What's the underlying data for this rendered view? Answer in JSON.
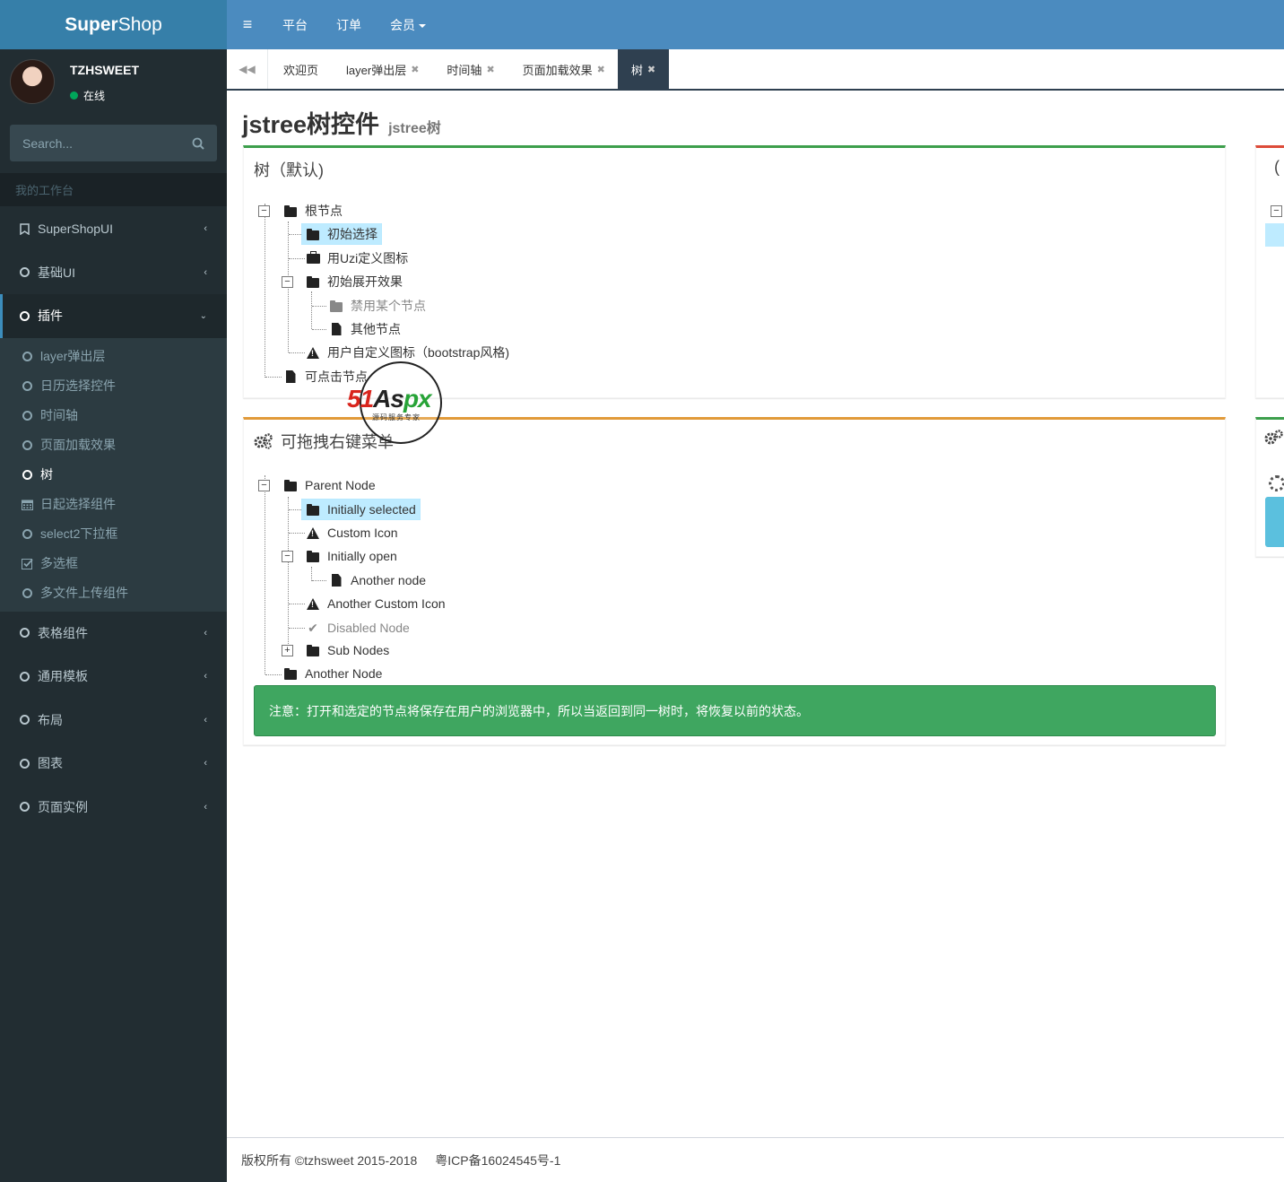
{
  "brand": {
    "bold": "Super",
    "light": "Shop"
  },
  "user": {
    "name": "TZHSWEET",
    "status": "在线"
  },
  "search": {
    "placeholder": "Search..."
  },
  "sidebar": {
    "section_header": "我的工作台",
    "items": [
      {
        "label": "SuperShopUI",
        "icon": "bookmark-icon"
      },
      {
        "label": "基础UI",
        "icon": "circle-icon"
      },
      {
        "label": "插件",
        "icon": "circle-icon",
        "active": true
      },
      {
        "label": "表格组件",
        "icon": "circle-icon"
      },
      {
        "label": "通用模板",
        "icon": "circle-icon"
      },
      {
        "label": "布局",
        "icon": "circle-icon"
      },
      {
        "label": "图表",
        "icon": "circle-icon"
      },
      {
        "label": "页面实例",
        "icon": "circle-icon"
      }
    ],
    "submenu": [
      {
        "label": "layer弹出层",
        "icon": "circle-icon"
      },
      {
        "label": "日历选择控件",
        "icon": "circle-icon"
      },
      {
        "label": "时间轴",
        "icon": "circle-icon"
      },
      {
        "label": "页面加载效果",
        "icon": "circle-icon"
      },
      {
        "label": "树",
        "icon": "circle-icon",
        "active": true
      },
      {
        "label": "日起选择组件",
        "icon": "calendar-icon"
      },
      {
        "label": "select2下拉框",
        "icon": "circle-icon"
      },
      {
        "label": "多选框",
        "icon": "checkbox-icon"
      },
      {
        "label": "多文件上传组件",
        "icon": "circle-icon"
      }
    ]
  },
  "navbar": {
    "links": [
      "平台",
      "订单",
      "会员"
    ]
  },
  "tabs": [
    {
      "label": "欢迎页",
      "closable": false
    },
    {
      "label": "layer弹出层",
      "closable": true
    },
    {
      "label": "时间轴",
      "closable": true
    },
    {
      "label": "页面加载效果",
      "closable": true
    },
    {
      "label": "树",
      "closable": true,
      "active": true
    }
  ],
  "page": {
    "title": "jstree树控件",
    "subtitle": "jstree树"
  },
  "box1": {
    "title": "树（默认)",
    "nodes": [
      "根节点",
      "初始选择",
      "用Uzi定义图标",
      "初始展开效果",
      "禁用某个节点",
      "其他节点",
      "用户自定义图标（bootstrap风格)",
      "可点击节点"
    ]
  },
  "box2": {
    "title": "可拖拽右键菜单",
    "nodes": [
      "Parent Node",
      "Initially selected",
      "Custom Icon",
      "Initially open",
      "Another node",
      "Another Custom Icon",
      "Disabled Node",
      "Sub Nodes",
      "Another Node"
    ],
    "alert": "注意：打开和选定的节点将保存在用户的浏览器中，所以当返回到同一树时，将恢复以前的状态。"
  },
  "right_box_title_fragment": "(",
  "watermark": {
    "red": "51",
    "black": "As",
    "green": "px",
    "sub": "源码服务专家"
  },
  "footer": {
    "copyright": "版权所有 ©tzhsweet 2015-2018",
    "icp": "粤ICP备16024545号-1"
  },
  "colors": {
    "sidebar_bg": "#222d32",
    "navbar_bg": "#4b8bbf",
    "active_tab_bg": "#2f4050",
    "alert_bg": "#3fa660",
    "box_green": "#3d9f4c",
    "box_orange": "#e19a39",
    "box_red": "#dd4b39"
  }
}
